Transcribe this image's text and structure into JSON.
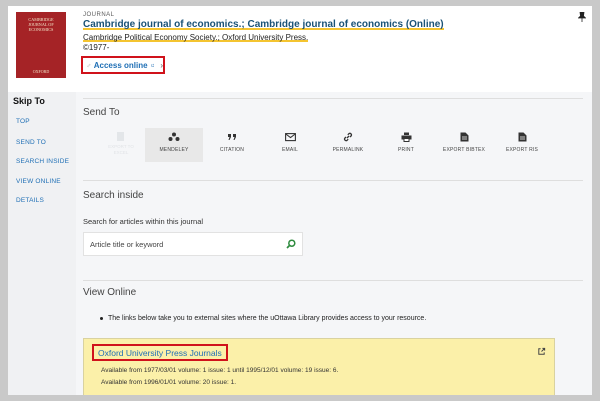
{
  "header": {
    "type_label": "JOURNAL",
    "title": "Cambridge journal of economics.; Cambridge journal of economics (Online)",
    "publisher": "Cambridge Political Economy Society.; Oxford University Press.",
    "date": "©1977-",
    "access_online": "Access online",
    "cover": {
      "text": "CAMBRIDGE JOURNAL OF ECONOMICS",
      "bottom_text": "OXFORD"
    }
  },
  "skip_to": {
    "title": "Skip To",
    "items": [
      "TOP",
      "SEND TO",
      "SEARCH INSIDE",
      "VIEW ONLINE",
      "DETAILS"
    ]
  },
  "send_to": {
    "title": "Send To",
    "items": [
      {
        "label": "MENDELEY",
        "icon": "mendeley-icon"
      },
      {
        "label": "CITATION",
        "icon": "quote-icon"
      },
      {
        "label": "EMAIL",
        "icon": "envelope-icon"
      },
      {
        "label": "PERMALINK",
        "icon": "link-icon"
      },
      {
        "label": "PRINT",
        "icon": "printer-icon"
      },
      {
        "label": "EXPORT BIBTEX",
        "icon": "document-icon"
      },
      {
        "label": "EXPORT RIS",
        "icon": "document-icon"
      }
    ],
    "ghost_label": "EXPORT TO EXCEL"
  },
  "search_inside": {
    "title": "Search inside",
    "subtitle": "Search for articles within this journal",
    "placeholder": "Article title or keyword"
  },
  "view_online": {
    "title": "View Online",
    "bullet": "The links below take you to external sites where the uOttawa Library provides access to your resource.",
    "provider": "Oxford University Press Journals",
    "availability": [
      "Available from 1977/03/01 volume: 1 issue: 1 until 1995/12/01 volume: 19 issue: 6.",
      "Available from 1996/01/01 volume: 20 issue: 1."
    ]
  },
  "colors": {
    "link": "#1f6fb5",
    "highlight_box": "#d0121b",
    "provider_card": "#fbf0a9",
    "underline": "#f4c430",
    "search_icon": "#2e8b3e"
  }
}
